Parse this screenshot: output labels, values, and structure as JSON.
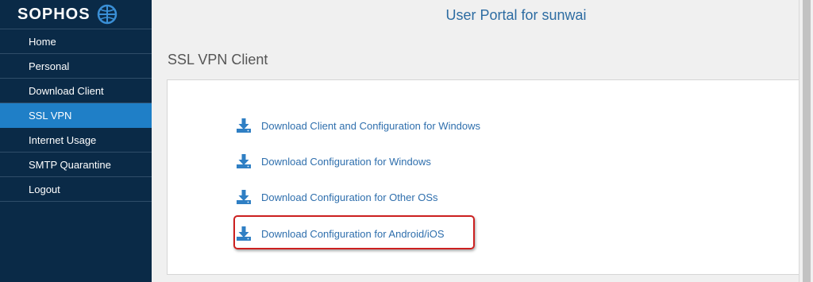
{
  "sidebar": {
    "logo_text": "SOPHOS",
    "items": [
      {
        "label": "Home"
      },
      {
        "label": "Personal"
      },
      {
        "label": "Download Client"
      },
      {
        "label": "SSL VPN",
        "active": true
      },
      {
        "label": "Internet Usage"
      },
      {
        "label": "SMTP Quarantine"
      },
      {
        "label": "Logout"
      }
    ]
  },
  "header": {
    "title": "User Portal for sunwai"
  },
  "main": {
    "section_title": "SSL VPN Client",
    "downloads": [
      {
        "label": "Download Client and Configuration for Windows",
        "icon": "download-icon"
      },
      {
        "label": "Download Configuration for Windows",
        "icon": "download-icon"
      },
      {
        "label": "Download Configuration for Other OSs",
        "icon": "download-icon"
      },
      {
        "label": "Download Configuration for Android/iOS",
        "icon": "download-icon",
        "highlighted": true
      }
    ]
  },
  "colors": {
    "sidebar_bg": "#0a2a47",
    "active_item": "#1f7fc7",
    "link": "#2f6fad",
    "title": "#2d6ca2",
    "highlight": "#cc2020"
  }
}
